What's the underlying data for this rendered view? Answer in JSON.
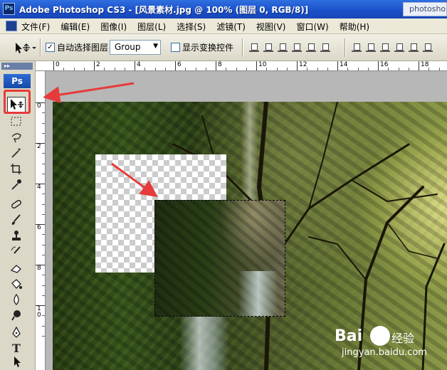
{
  "titlebar": {
    "app_icon_label": "Ps",
    "title": "Adobe Photoshop CS3 - [风景素材.jpg @ 100% (图层 0, RGB/8)]",
    "ghost_tab": "photosho"
  },
  "menubar": {
    "items": [
      "文件(F)",
      "编辑(E)",
      "图像(I)",
      "图层(L)",
      "选择(S)",
      "滤镜(T)",
      "视图(V)",
      "窗口(W)",
      "帮助(H)"
    ]
  },
  "options": {
    "auto_select_label": "自动选择图层",
    "auto_select_checked": true,
    "select_value": "Group",
    "show_transform_label": "显示变换控件",
    "show_transform_checked": false
  },
  "toolbox": {
    "grip": "▸▸",
    "logo": "Ps",
    "tools": [
      "move-tool",
      "marquee-tool",
      "lasso-tool",
      "magic-wand-tool",
      "crop-tool",
      "eyedropper-tool",
      "healing-brush-tool",
      "brush-tool",
      "clone-stamp-tool",
      "history-brush-tool",
      "eraser-tool",
      "paint-bucket-tool",
      "blur-tool",
      "dodge-tool",
      "pen-tool",
      "type-tool",
      "path-selection-tool"
    ],
    "type_glyph": "T"
  },
  "rulers": {
    "h_labels": [
      "0",
      "2",
      "4",
      "6",
      "8",
      "10",
      "12",
      "14",
      "16",
      "18"
    ],
    "v_labels": [
      "0",
      "2",
      "4",
      "6",
      "8",
      "1\n0"
    ]
  },
  "watermark": {
    "brand": "Bai",
    "cn": "经验",
    "url": "jingyan.baidu.com"
  },
  "colors": {
    "annotation_red": "#e63b3b",
    "title_blue": "#1a4fc8"
  }
}
